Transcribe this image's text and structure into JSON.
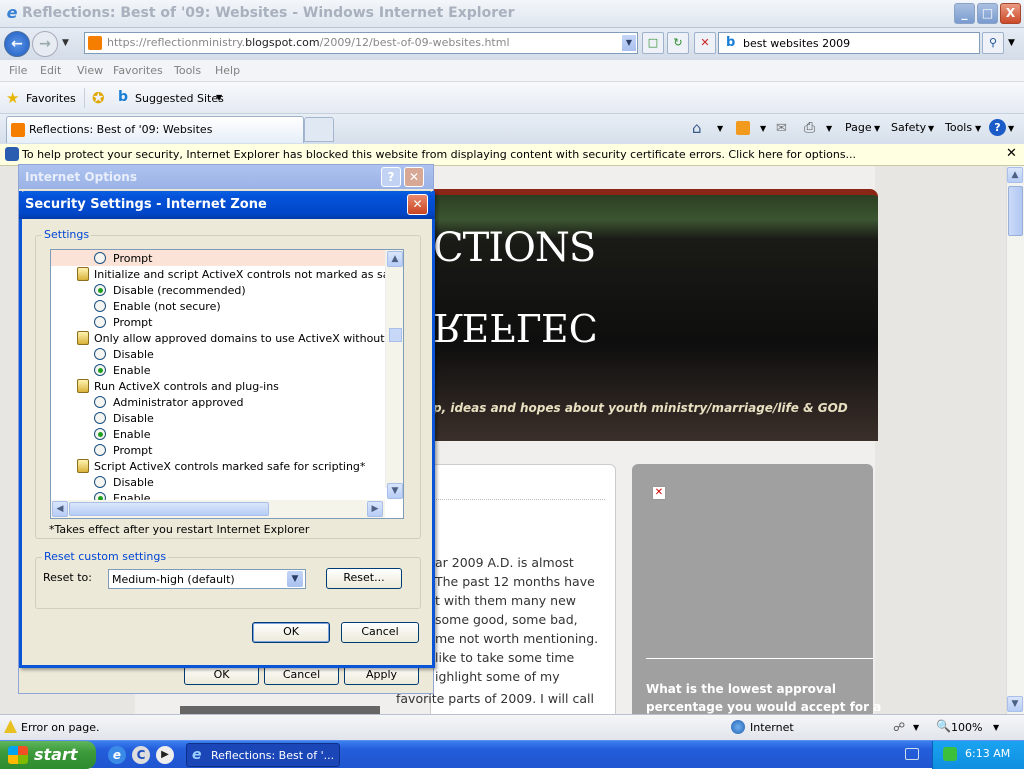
{
  "window": {
    "title": "Reflections: Best of '09: Websites - Windows Internet Explorer",
    "min": "_",
    "max": "□",
    "close": "X"
  },
  "address": {
    "url_prefix": "https://reflectionministry.",
    "url_domain": "blogspot.com",
    "url_path": "/2009/12/best-of-09-websites.html",
    "search_value": "best websites 2009"
  },
  "menu": {
    "file": "File",
    "edit": "Edit",
    "view": "View",
    "favorites": "Favorites",
    "tools": "Tools",
    "help": "Help"
  },
  "favbar": {
    "favorites": "Favorites",
    "suggested": "Suggested Sites"
  },
  "tab": {
    "title": "Reflections: Best of '09: Websites"
  },
  "commands": {
    "page": "Page",
    "safety": "Safety",
    "tools": "Tools"
  },
  "infobar": {
    "text": "To help protect your security, Internet Explorer has blocked this website from displaying content with security certificate errors. Click here for options..."
  },
  "page": {
    "header_title": "CTIONS",
    "header_mirror": "REFLEC",
    "tagline": "p, ideas and hopes about youth ministry/marriage/life & GOD",
    "post_lines": [
      "ar 2009 A.D. is almost",
      "The past 12 months have",
      "t with them many new",
      "some good, some bad,",
      "me not worth mentioning.",
      "like to take some time",
      "ighlight some of my",
      "favorite parts of 2009.  I will call"
    ],
    "sidebar_question": "What is the lowest approval",
    "sidebar_question2": "percentage you would accept for a"
  },
  "internet_options": {
    "title": "Internet Options",
    "ok": "OK",
    "cancel": "Cancel",
    "apply": "Apply"
  },
  "security_settings": {
    "title": "Security Settings - Internet Zone",
    "settings_label": "Settings",
    "items": [
      {
        "kind": "radio",
        "label": "Prompt",
        "checked": false,
        "highlight": true
      },
      {
        "kind": "header",
        "label": "Initialize and script ActiveX controls not marked as safe for s"
      },
      {
        "kind": "radio",
        "label": "Disable (recommended)",
        "checked": true
      },
      {
        "kind": "radio",
        "label": "Enable (not secure)",
        "checked": false
      },
      {
        "kind": "radio",
        "label": "Prompt",
        "checked": false
      },
      {
        "kind": "header",
        "label": "Only allow approved domains to use ActiveX without prompt"
      },
      {
        "kind": "radio",
        "label": "Disable",
        "checked": false
      },
      {
        "kind": "radio",
        "label": "Enable",
        "checked": true
      },
      {
        "kind": "header",
        "label": "Run ActiveX controls and plug-ins"
      },
      {
        "kind": "radio",
        "label": "Administrator approved",
        "checked": false
      },
      {
        "kind": "radio",
        "label": "Disable",
        "checked": false
      },
      {
        "kind": "radio",
        "label": "Enable",
        "checked": true
      },
      {
        "kind": "radio",
        "label": "Prompt",
        "checked": false
      },
      {
        "kind": "header",
        "label": "Script ActiveX controls marked safe for scripting*"
      },
      {
        "kind": "radio",
        "label": "Disable",
        "checked": false
      },
      {
        "kind": "radio",
        "label": "Enable",
        "checked": true
      }
    ],
    "note": "*Takes effect after you restart Internet Explorer",
    "reset_group": "Reset custom settings",
    "reset_to": "Reset to:",
    "reset_value": "Medium-high (default)",
    "reset_button": "Reset...",
    "ok": "OK",
    "cancel": "Cancel"
  },
  "status": {
    "error": "Error on page.",
    "zone": "Internet",
    "zoom": "100%"
  },
  "taskbar": {
    "start": "start",
    "item": "Reflections: Best of '...",
    "clock": "6:13 AM"
  }
}
